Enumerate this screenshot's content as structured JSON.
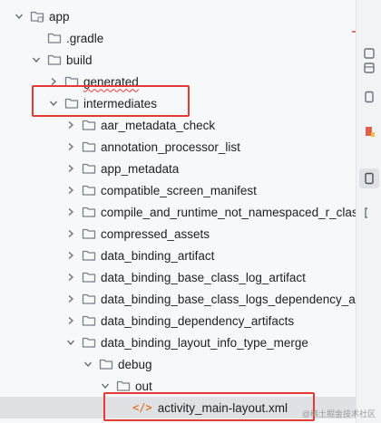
{
  "project_tree": {
    "items": [
      {
        "label": "app",
        "level": 0,
        "expanded": true,
        "kind": "module"
      },
      {
        "label": ".gradle",
        "level": 1,
        "kind": "folder",
        "leaf": true
      },
      {
        "label": "build",
        "level": 1,
        "expanded": true,
        "kind": "folder"
      },
      {
        "label": "generated",
        "level": 2,
        "expanded": false,
        "kind": "folder",
        "squiggle": true
      },
      {
        "label": "intermediates",
        "level": 2,
        "expanded": true,
        "kind": "folder"
      },
      {
        "label": "aar_metadata_check",
        "level": 3,
        "expanded": false,
        "kind": "folder"
      },
      {
        "label": "annotation_processor_list",
        "level": 3,
        "expanded": false,
        "kind": "folder"
      },
      {
        "label": "app_metadata",
        "level": 3,
        "expanded": false,
        "kind": "folder"
      },
      {
        "label": "compatible_screen_manifest",
        "level": 3,
        "expanded": false,
        "kind": "folder"
      },
      {
        "label": "compile_and_runtime_not_namespaced_r_class_",
        "level": 3,
        "expanded": false,
        "kind": "folder"
      },
      {
        "label": "compressed_assets",
        "level": 3,
        "expanded": false,
        "kind": "folder"
      },
      {
        "label": "data_binding_artifact",
        "level": 3,
        "expanded": false,
        "kind": "folder"
      },
      {
        "label": "data_binding_base_class_log_artifact",
        "level": 3,
        "expanded": false,
        "kind": "folder"
      },
      {
        "label": "data_binding_base_class_logs_dependency_arti",
        "level": 3,
        "expanded": false,
        "kind": "folder"
      },
      {
        "label": "data_binding_dependency_artifacts",
        "level": 3,
        "expanded": false,
        "kind": "folder"
      },
      {
        "label": "data_binding_layout_info_type_merge",
        "level": 3,
        "expanded": true,
        "kind": "folder"
      },
      {
        "label": "debug",
        "level": 4,
        "expanded": true,
        "kind": "folder"
      },
      {
        "label": "out",
        "level": 5,
        "expanded": true,
        "kind": "folder"
      },
      {
        "label": "activity_main-layout.xml",
        "level": 6,
        "kind": "xml",
        "leaf": true,
        "selected": true
      }
    ]
  },
  "colors": {
    "folder": "#7a7f87",
    "highlight": "#e53935",
    "xml": "#e07a2e",
    "selection": "#dfe1e5"
  },
  "watermark": "@稀土掘金技术社区"
}
